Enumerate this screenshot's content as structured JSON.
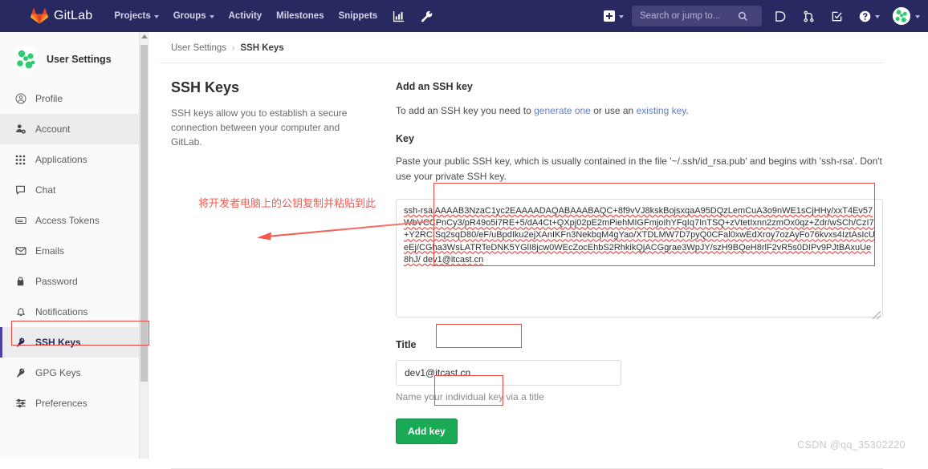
{
  "navbar": {
    "brand": "GitLab",
    "links": [
      {
        "label": "Projects",
        "caret": true
      },
      {
        "label": "Groups",
        "caret": true
      },
      {
        "label": "Activity",
        "caret": false
      },
      {
        "label": "Milestones",
        "caret": false
      },
      {
        "label": "Snippets",
        "caret": false
      }
    ],
    "icons": [
      {
        "name": "analytics-chart-icon"
      },
      {
        "name": "wrench-admin-icon"
      }
    ],
    "create_new_label": "",
    "search_placeholder": "Search or jump to...",
    "right_icons": [
      {
        "name": "issues-icon"
      },
      {
        "name": "merge-requests-icon"
      },
      {
        "name": "todos-icon"
      },
      {
        "name": "help-icon"
      }
    ]
  },
  "sidebar": {
    "title": "User Settings",
    "items": [
      {
        "label": "Profile",
        "icon": "user-circle-icon",
        "state": "normal"
      },
      {
        "label": "Account",
        "icon": "account-gear-icon",
        "state": "hovered"
      },
      {
        "label": "Applications",
        "icon": "apps-grid-icon",
        "state": "normal"
      },
      {
        "label": "Chat",
        "icon": "chat-bubble-icon",
        "state": "normal"
      },
      {
        "label": "Access Tokens",
        "icon": "token-card-icon",
        "state": "normal"
      },
      {
        "label": "Emails",
        "icon": "envelope-icon",
        "state": "normal"
      },
      {
        "label": "Password",
        "icon": "lock-icon",
        "state": "normal"
      },
      {
        "label": "Notifications",
        "icon": "bell-icon",
        "state": "normal"
      },
      {
        "label": "SSH Keys",
        "icon": "key-icon",
        "state": "active"
      },
      {
        "label": "GPG Keys",
        "icon": "key-icon",
        "state": "normal"
      },
      {
        "label": "Preferences",
        "icon": "sliders-icon",
        "state": "normal"
      }
    ]
  },
  "breadcrumb": {
    "root": "User Settings",
    "separator": "›",
    "current": "SSH Keys"
  },
  "left_panel": {
    "heading": "SSH Keys",
    "description": "SSH keys allow you to establish a secure connection between your computer and GitLab."
  },
  "form": {
    "heading": "Add an SSH key",
    "intro_before": "To add an SSH key you need to ",
    "intro_link1": "generate one",
    "intro_middle": " or use an ",
    "intro_link2": "existing key",
    "intro_after": ".",
    "key_label": "Key",
    "key_help": "Paste your public SSH key, which is usually contained in the file '~/.ssh/id_rsa.pub' and begins with 'ssh-rsa'. Don't use your private SSH key.",
    "key_value": "ssh-rsa AAAAB3NzaC1yc2EAAAADAQABAAABAQC+8f9vVJ8kskBojsxqaA95DQzLemCuA3o9nWE1sCjHHy/xxT4Ev57WbVCCPnCy3/pR49o5i7RE+5/dA4Ct+QXpj02pE2mPiehMIGFmjoIhYFqIq7InTSQ+zVtetIxnn2zmOx0qz+Zdr/wSCh/CzI7+Y2RCISq2sqD80/eF/uBpdIku2ejXAnIKFn3NekbqM4gYao/XTDLMW7D7pyQ0CFal0xwEdXroy7ozAyFo76kvxs4IztAsIcUeEj/CGha3WsLATRTeDNK5YGlI8jcw0WEcZocEhbS2RhkikQjACGgrae3WpJY/szH9BQeH8rlF2vR5s0DIPv9PJtBAxuUe8hJ/ dev1@itcast.cn",
    "title_label": "Title",
    "title_value": "dev1@itcast.cn",
    "title_help": "Name your individual key via a title",
    "submit_label": "Add key"
  },
  "annotations": {
    "note_text": "将开发者电脑上的公钥复制并粘贴到此",
    "color": "#f5584e"
  },
  "watermark": "CSDN @qq_35302220",
  "colors": {
    "navbar_bg": "#292961",
    "accent_green": "#1aaa55",
    "link_blue": "#5b7fc7",
    "annotation_red": "#e8483f",
    "active_indicator": "#4b43a8"
  }
}
